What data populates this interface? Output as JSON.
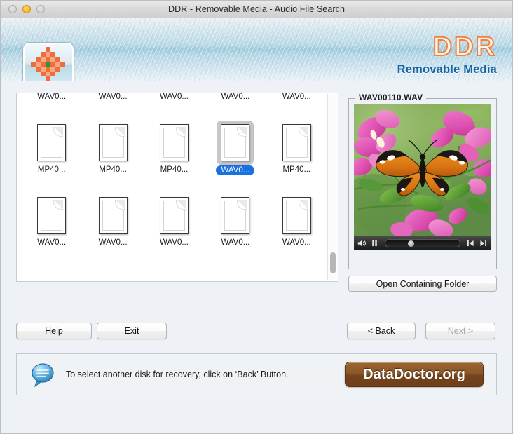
{
  "window": {
    "title": "DDR - Removable Media - Audio File Search",
    "traffic": {
      "close": "close-button",
      "minimize": "minimize-button",
      "zoom": "zoom-button"
    }
  },
  "banner": {
    "brand": "DDR",
    "subtitle": "Removable Media",
    "app_icon": "flower-checker-icon",
    "colors": {
      "brand_outline": "#f2803c",
      "subtitle": "#1464a5"
    }
  },
  "filelist": {
    "rows": [
      {
        "clipped": true,
        "items": [
          {
            "label": "WAV0...",
            "selected": false
          },
          {
            "label": "WAV0...",
            "selected": false
          },
          {
            "label": "WAV0...",
            "selected": false
          },
          {
            "label": "WAV0...",
            "selected": false
          },
          {
            "label": "WAV0...",
            "selected": false
          }
        ]
      },
      {
        "clipped": false,
        "items": [
          {
            "label": "MP40...",
            "selected": false
          },
          {
            "label": "MP40...",
            "selected": false
          },
          {
            "label": "MP40...",
            "selected": false
          },
          {
            "label": "WAV0...",
            "selected": true
          },
          {
            "label": "MP40...",
            "selected": false
          }
        ]
      },
      {
        "clipped": false,
        "items": [
          {
            "label": "WAV0...",
            "selected": false
          },
          {
            "label": "WAV0...",
            "selected": false
          },
          {
            "label": "WAV0...",
            "selected": false
          },
          {
            "label": "WAV0...",
            "selected": false
          },
          {
            "label": "WAV0...",
            "selected": false
          }
        ]
      }
    ],
    "scrollbar": "vertical-scrollbar"
  },
  "preview": {
    "legend": "WAV00110.WAV",
    "thumbnail": "butterfly-on-pink-flowers-image",
    "player": {
      "volume": "speaker-icon",
      "pause": "pause-icon",
      "step_back": "step-back-icon",
      "step_forward": "step-forward-icon",
      "progress_percent": 30
    },
    "open_folder_label": "Open Containing Folder"
  },
  "nav": {
    "help": "Help",
    "exit": "Exit",
    "back": "< Back",
    "next": "Next >",
    "next_disabled": true
  },
  "status": {
    "icon": "speech-bubble-icon",
    "message": "To select another disk for recovery, click on ‘Back’ Button.",
    "brand_button": "DataDoctor.org"
  }
}
